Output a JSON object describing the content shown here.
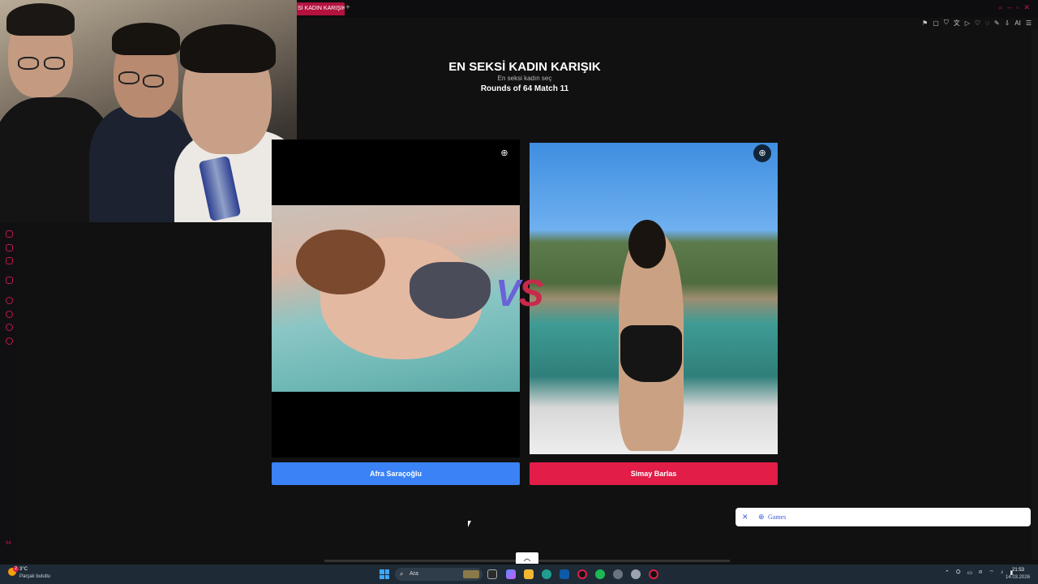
{
  "browser": {
    "tab_title": "Sİ KADIN KARIŞIK",
    "new_tab": "+",
    "toolbar_ai": "AI"
  },
  "page": {
    "title": "EN SEKSİ KADIN KARIŞIK",
    "subtitle": "En seksi kadın seç",
    "round": "Rounds of 64 Match 11",
    "vs_v": "V",
    "vs_s": "S"
  },
  "left": {
    "name": "Afra Saraçoğlu"
  },
  "right": {
    "name": "Simay Barlas"
  },
  "games_popup": {
    "label": "Games"
  },
  "sidebar": {
    "counter": "64"
  },
  "taskbar": {
    "weather_temp": "3°C",
    "weather_desc": "Parçalı bulutlu",
    "weather_badge": "2",
    "search_placeholder": "Ara",
    "time": "21:53",
    "date": "14.03.2026"
  },
  "colors": {
    "accent": "#c0184a",
    "left_button": "#3a82f6",
    "right_button": "#e11d48"
  }
}
